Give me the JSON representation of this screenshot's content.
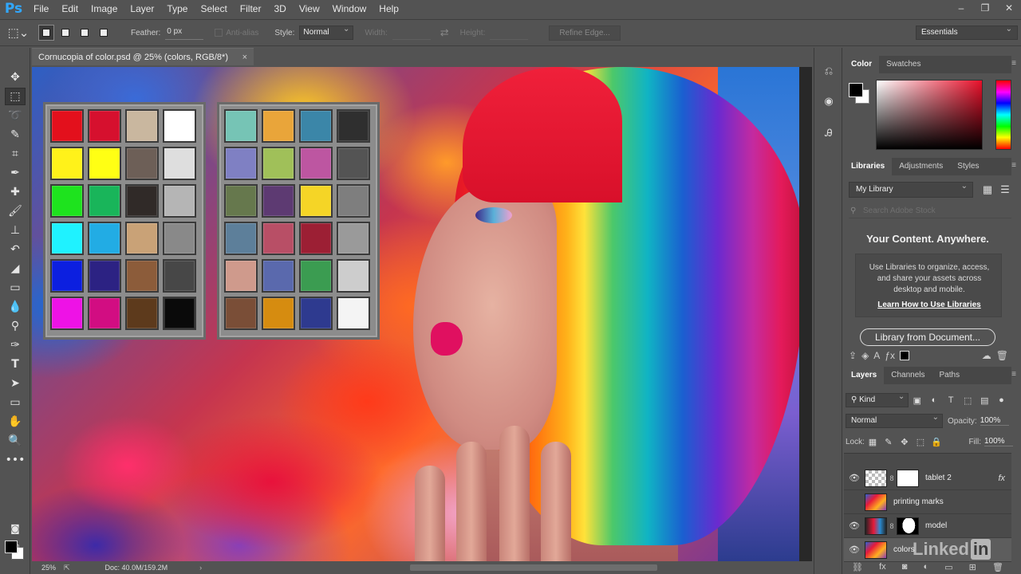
{
  "app": {
    "logo": "Ps"
  },
  "menu": [
    "File",
    "Edit",
    "Image",
    "Layer",
    "Type",
    "Select",
    "Filter",
    "3D",
    "View",
    "Window",
    "Help"
  ],
  "window_controls": [
    "–",
    "❐",
    "✕"
  ],
  "options": {
    "feather_label": "Feather:",
    "feather_value": "0 px",
    "antialias_label": "Anti-alias",
    "style_label": "Style:",
    "style_value": "Normal",
    "width_label": "Width:",
    "height_label": "Height:",
    "refine_label": "Refine Edge...",
    "workspace": "Essentials"
  },
  "document": {
    "tab_title": "Cornucopia of color.psd @ 25% (colors, RGB/8*)",
    "close": "×",
    "zoom": "25%",
    "doc_info": "Doc: 40.0M/159.2M",
    "arrow": "›"
  },
  "swatches": {
    "tablet1": [
      "#e3101c",
      "#d6102e",
      "#c9b79f",
      "#ffffff",
      "#fff21a",
      "#ffff14",
      "#6d5f57",
      "#dedede",
      "#1ee31e",
      "#19b55a",
      "#302a28",
      "#b5b5b5",
      "#1ff2ff",
      "#22ace4",
      "#c9a277",
      "#898989",
      "#0c1fe0",
      "#2c2283",
      "#8c5c3a",
      "#474747",
      "#ee12e6",
      "#d20d82",
      "#5d3a1c",
      "#0a0a0a"
    ],
    "tablet2": [
      "#76c4b5",
      "#e9a53a",
      "#3b86a8",
      "#2f2f2f",
      "#7f80c3",
      "#a0c059",
      "#bd56a1",
      "#545454",
      "#66784d",
      "#5d3a72",
      "#f5d526",
      "#7e7e7e",
      "#5d7f9a",
      "#b84f66",
      "#9c1f34",
      "#9a9a9a",
      "#cf9a8c",
      "#5a69ad",
      "#3b9c51",
      "#cdcdcd",
      "#7a4e37",
      "#d68c10",
      "#2e3a8f",
      "#f4f4f4"
    ]
  },
  "color_panel": {
    "tabs": [
      "Color",
      "Swatches"
    ],
    "fg": "#000000",
    "bg": "#ffffff"
  },
  "libraries_panel": {
    "tabs": [
      "Libraries",
      "Adjustments",
      "Styles"
    ],
    "library_name": "My Library",
    "search_placeholder": "Search Adobe Stock",
    "heading": "Your Content. Anywhere.",
    "description": "Use Libraries to organize, access, and share your assets across desktop and mobile.",
    "link": "Learn How to Use Libraries",
    "button": "Library from Document..."
  },
  "layers_panel": {
    "tabs": [
      "Layers",
      "Channels",
      "Paths"
    ],
    "kind": "Kind",
    "blend_mode": "Normal",
    "opacity_label": "Opacity:",
    "opacity_value": "100%",
    "lock_label": "Lock:",
    "fill_label": "Fill:",
    "fill_value": "100%",
    "layers": [
      {
        "name": "tablet 2",
        "visible": true,
        "fx": "fx"
      },
      {
        "name": "printing marks",
        "visible": false
      },
      {
        "name": "model",
        "visible": true
      },
      {
        "name": "colors",
        "visible": true,
        "selected": true
      }
    ]
  },
  "watermark": {
    "text": "Linked",
    "badge": "in"
  }
}
